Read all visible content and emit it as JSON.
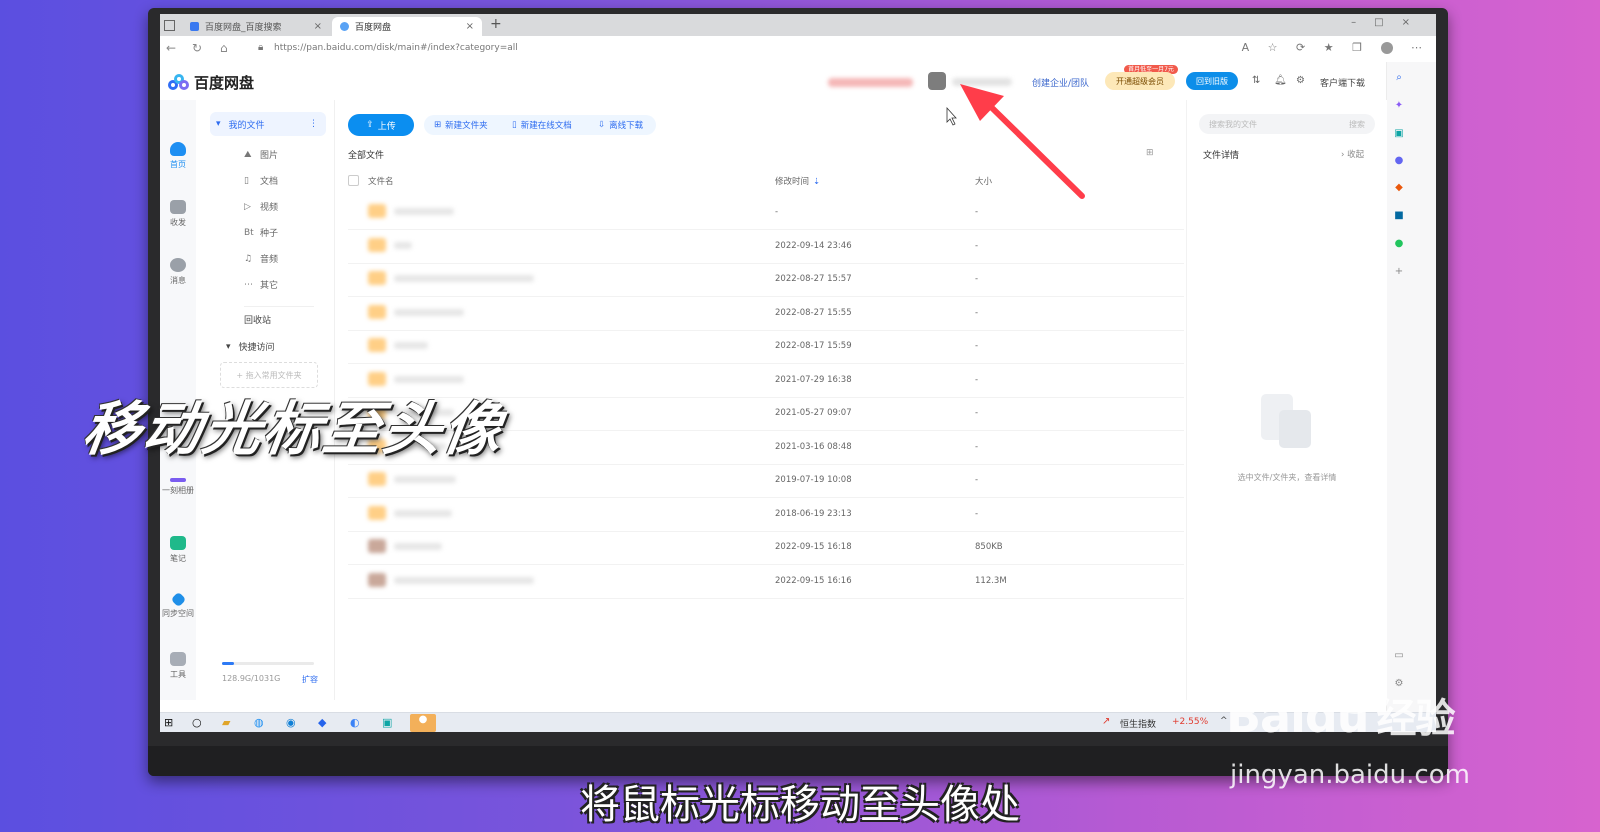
{
  "browser": {
    "tabs": [
      {
        "label": "百度网盘_百度搜索",
        "active": false
      },
      {
        "label": "百度网盘",
        "active": true
      }
    ],
    "url": "https://pan.baidu.com/disk/main#/index?category=all"
  },
  "app": {
    "logo_text": "百度网盘",
    "header": {
      "enterprise_link": "创建企业/团队",
      "vip_tag": "首月低至一月7元",
      "vip_button": "开通超级会员",
      "old_version_button": "回到旧版",
      "client_download": "客户端下载"
    },
    "rail": [
      {
        "label": "首页",
        "icon": "home-cloud-icon",
        "color": "#1e8ff2"
      },
      {
        "label": "收发",
        "icon": "transfer-icon",
        "color": "#888888"
      },
      {
        "label": "消息",
        "icon": "contacts-icon",
        "color": "#888888"
      },
      {
        "label": "一刻相册",
        "icon": "album-icon",
        "color": "#7a5cf0"
      },
      {
        "label": "笔记",
        "icon": "notes-icon",
        "color": "#1fb98a"
      },
      {
        "label": "同步空间",
        "icon": "sync-icon",
        "color": "#1f8fe8"
      },
      {
        "label": "工具",
        "icon": "tools-icon",
        "color": "#888888"
      }
    ],
    "subnav": {
      "my_files": "我的文件",
      "categories": [
        {
          "label": "图片",
          "icon": "image-icon"
        },
        {
          "label": "文档",
          "icon": "document-icon"
        },
        {
          "label": "视频",
          "icon": "video-icon"
        },
        {
          "label": "种子",
          "icon": "torrent-icon"
        },
        {
          "label": "音频",
          "icon": "audio-icon"
        },
        {
          "label": "其它",
          "icon": "more-icon"
        }
      ],
      "recycle": "回收站",
      "quick_access": "快捷访问",
      "quick_add_placeholder": "+ 拖入常用文件夹",
      "storage": "128.9G/1031G",
      "storage_used_fraction": 0.125,
      "expand": "扩容"
    },
    "toolbar": {
      "upload": "上传",
      "new_folder": "新建文件夹",
      "new_online_doc": "新建在线文档",
      "offline_download": "离线下载"
    },
    "breadcrumb": "全部文件",
    "table": {
      "headers": {
        "name": "文件名",
        "modified": "修改时间",
        "size": "大小"
      },
      "rows": [
        {
          "modified": "-",
          "size": "-"
        },
        {
          "modified": "2022-09-14 23:46",
          "size": "-"
        },
        {
          "modified": "2022-08-27 15:57",
          "size": "-"
        },
        {
          "modified": "2022-08-27 15:55",
          "size": "-"
        },
        {
          "modified": "2022-08-17 15:59",
          "size": "-"
        },
        {
          "modified": "2021-07-29 16:38",
          "size": "-"
        },
        {
          "modified": "2021-05-27 09:07",
          "size": "-"
        },
        {
          "modified": "2021-03-16 08:48",
          "size": "-"
        },
        {
          "modified": "2019-07-19 10:08",
          "size": "-"
        },
        {
          "modified": "2018-06-19 23:13",
          "size": "-"
        },
        {
          "modified": "2022-09-15 16:18",
          "size": "850KB"
        },
        {
          "modified": "2022-09-15 16:16",
          "size": "112.3M"
        }
      ]
    },
    "detail": {
      "search_placeholder": "搜索我的文件",
      "search_button": "搜索",
      "title": "文件详情",
      "collapse": "收起",
      "empty_text": "选中文件/文件夹，查看详情"
    }
  },
  "taskbar": {
    "stock_name": "恒生指数",
    "stock_change": "+2.55%"
  },
  "overlay": {
    "caption": "移动光标至头像",
    "subtitle": "将鼠标光标移动至头像处",
    "watermark_brand": "Baidu",
    "watermark_cn": "经验",
    "watermark_url": "jingyan.baidu.com"
  }
}
